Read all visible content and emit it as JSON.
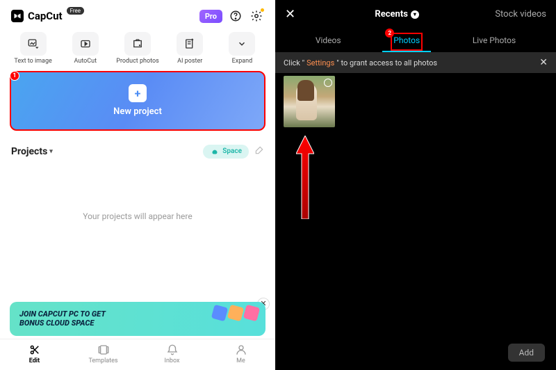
{
  "left": {
    "app_name": "CapCut",
    "free_label": "Free",
    "pro_label": "Pro",
    "tools": [
      {
        "label": "Text to image"
      },
      {
        "label": "AutoCut"
      },
      {
        "label": "Product photos"
      },
      {
        "label": "AI poster"
      }
    ],
    "expand_label": "Expand",
    "new_project": {
      "label": "New project",
      "callout_number": "1"
    },
    "projects_section": {
      "title": "Projects",
      "space_label": "Space",
      "empty_text": "Your projects will appear here"
    },
    "banner": {
      "line1": "JOIN CAPCUT PC TO GET",
      "line2": "BONUS CLOUD SPACE"
    },
    "nav": [
      {
        "label": "Edit",
        "active": true
      },
      {
        "label": "Templates",
        "active": false
      },
      {
        "label": "Inbox",
        "active": false
      },
      {
        "label": "Me",
        "active": false
      }
    ]
  },
  "right": {
    "recents_label": "Recents",
    "stock_label": "Stock videos",
    "tabs": [
      {
        "label": "Videos"
      },
      {
        "label": "Photos",
        "active": true,
        "callout_number": "2"
      },
      {
        "label": "Live Photos"
      }
    ],
    "permission_strip": {
      "prefix": "Click \"",
      "link": "Settings",
      "suffix": "\" to grant access to all photos"
    },
    "add_label": "Add"
  }
}
